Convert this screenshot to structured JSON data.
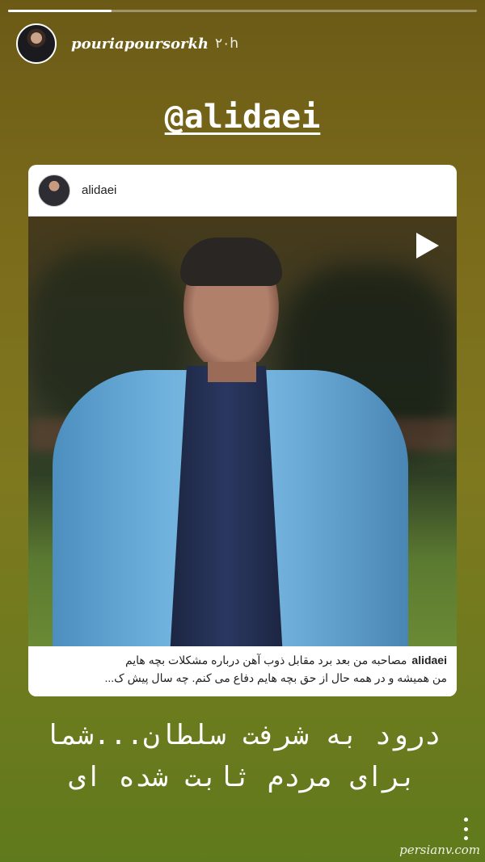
{
  "story": {
    "progress": 0.22,
    "username": "pouriapoursorkh",
    "time": "۲۰h",
    "mention": "@alidaei",
    "text_line1": "درود به شرفت سلطان...شما",
    "text_line2": "برای مردم ثابت شده ای"
  },
  "post": {
    "username": "alidaei",
    "caption_user": "alidaei",
    "caption_line1": "مصاحبه من بعد برد مقابل ذوب آهن درباره  مشکلات بچه هایم",
    "caption_line2": "من همیشه و در همه حال از حق بچه هایم دفاع می کنم. چه سال پیش ک..."
  },
  "watermark": "persianv.com",
  "icons": {
    "play": "play-icon",
    "more": "more-vertical-icon"
  },
  "colors": {
    "background_top": "#6b5a16",
    "background_bottom": "#5f7a1c",
    "card": "#ffffff"
  }
}
